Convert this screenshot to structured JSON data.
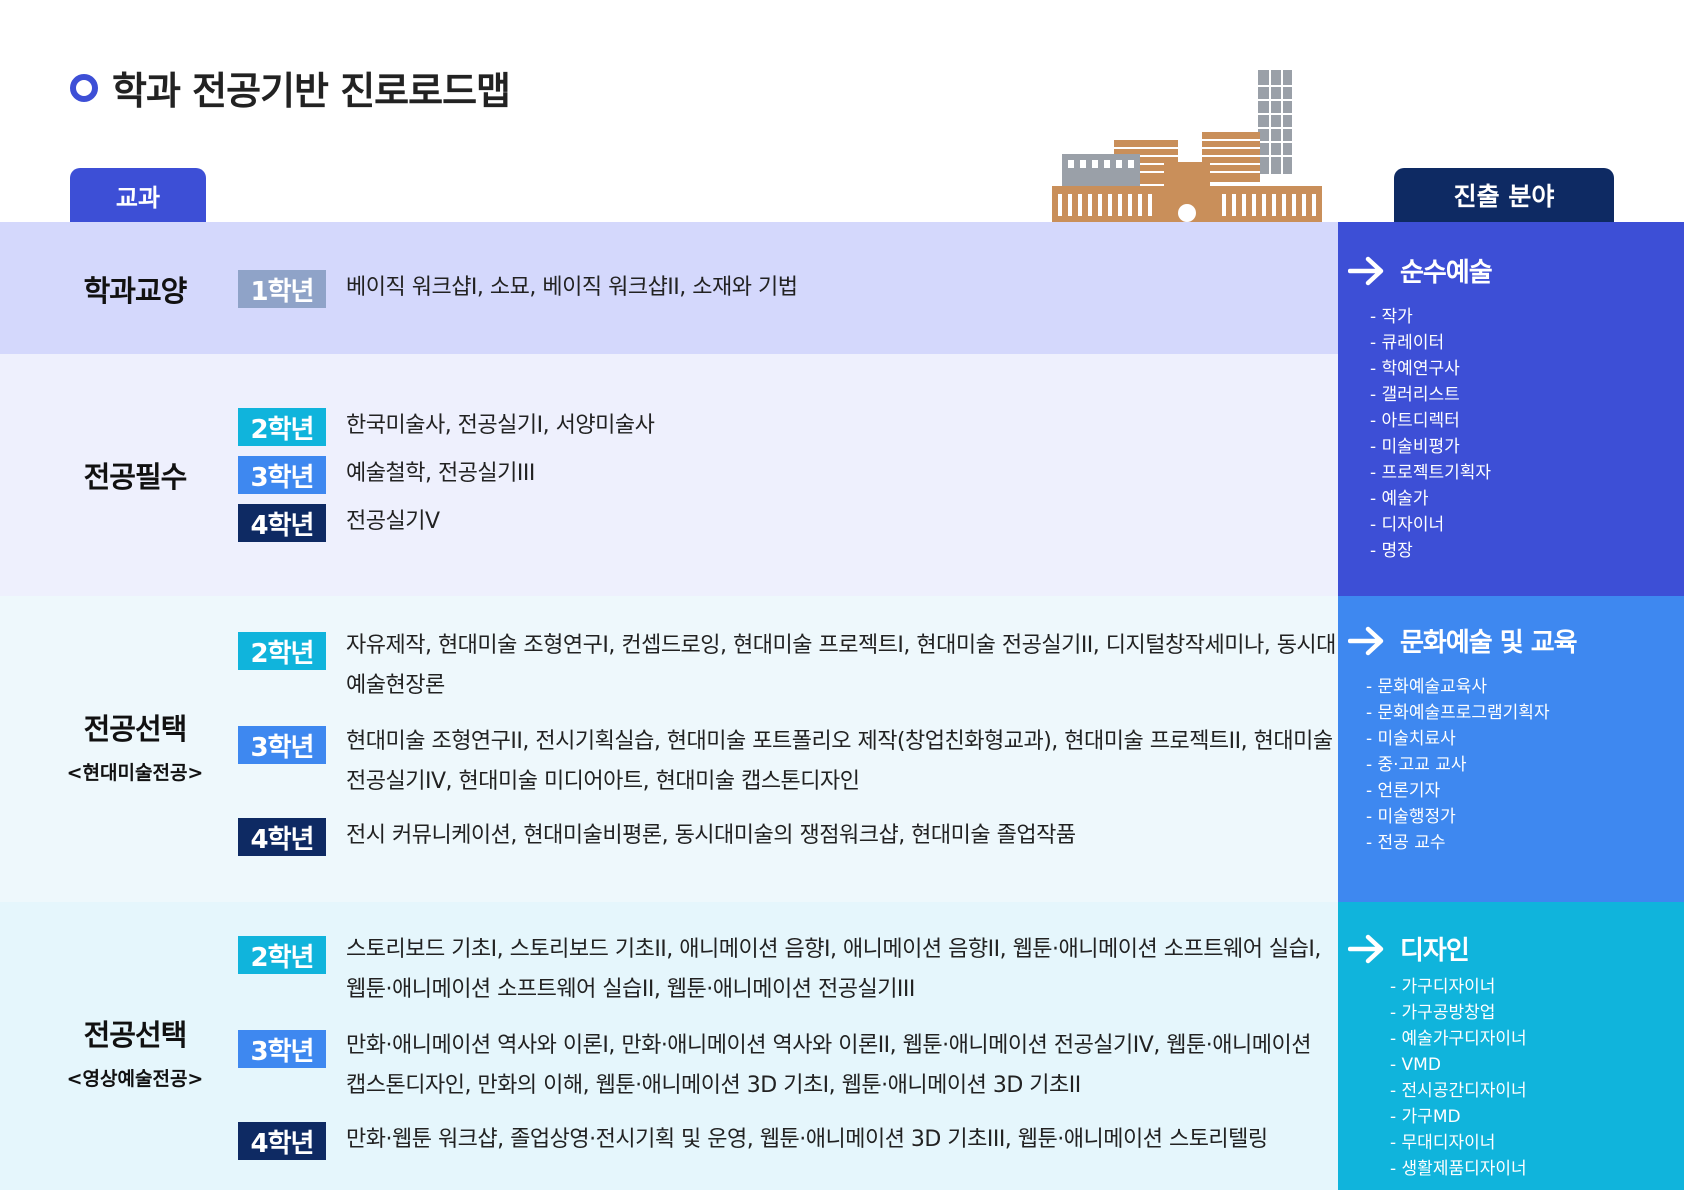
{
  "header": {
    "title": "학과 전공기반 진로로드맵",
    "left_tab": "교과",
    "right_tab": "진출 분야"
  },
  "rows": {
    "liberal": {
      "category": "학과교양",
      "items": [
        {
          "grade": "1학년",
          "courses": "베이직 워크샵I, 소묘, 베이직 워크샵II, 소재와 기법"
        }
      ]
    },
    "required": {
      "category": "전공필수",
      "items": [
        {
          "grade": "2학년",
          "courses": "한국미술사, 전공실기I, 서양미술사"
        },
        {
          "grade": "3학년",
          "courses": "예술철학, 전공실기III"
        },
        {
          "grade": "4학년",
          "courses": "전공실기V"
        }
      ]
    },
    "elective_contemporary": {
      "category": "전공선택",
      "sub": "<현대미술전공>",
      "items": [
        {
          "grade": "2학년",
          "courses": "자유제작, 현대미술 조형연구I, 컨셉드로잉, 현대미술 프로젝트I, 현대미술 전공실기II, 디지털창작세미나, 동시대예술현장론"
        },
        {
          "grade": "3학년",
          "courses": "현대미술 조형연구II, 전시기획실습, 현대미술 포트폴리오 제작(창업친화형교과), 현대미술 프로젝트II, 현대미술 전공실기IV, 현대미술 미디어아트, 현대미술 캡스톤디자인"
        },
        {
          "grade": "4학년",
          "courses": "전시 커뮤니케이션, 현대미술비평론, 동시대미술의 쟁점워크샵, 현대미술 졸업작품"
        }
      ]
    },
    "elective_media": {
      "category": "전공선택",
      "sub": "<영상예술전공>",
      "items": [
        {
          "grade": "2학년",
          "courses": "스토리보드 기초I, 스토리보드 기초II, 애니메이션 음향I, 애니메이션 음향II, 웹툰·애니메이션 소프트웨어 실습I, 웹툰·애니메이션 소프트웨어 실습II, 웹툰·애니메이션 전공실기III"
        },
        {
          "grade": "3학년",
          "courses": "만화·애니메이션 역사와 이론I, 만화·애니메이션 역사와 이론II, 웹툰·애니메이션 전공실기IV, 웹툰·애니메이션 캡스톤디자인, 만화의 이해, 웹툰·애니메이션 3D 기초I, 웹툰·애니메이션 3D 기초II"
        },
        {
          "grade": "4학년",
          "courses": "만화·웹툰 워크샵, 졸업상영·전시기획 및 운영, 웹툰·애니메이션 3D 기초III, 웹툰·애니메이션 스토리텔링"
        }
      ]
    }
  },
  "careers": {
    "fine_art": {
      "title": "순수예술",
      "items": [
        "- 작가",
        "- 큐레이터",
        "- 학예연구사",
        "- 갤러리스트",
        "- 아트디렉터",
        "- 미술비평가",
        "- 프로젝트기획자",
        "- 예술가",
        "- 디자이너",
        "- 명장"
      ]
    },
    "culture_edu": {
      "title": "문화예술 및 교육",
      "items": [
        "- 문화예술교육사",
        "- 문화예술프로그램기획자",
        "- 미술치료사",
        "- 중·고교 교사",
        "- 언론기자",
        "- 미술행정가",
        "- 전공 교수"
      ]
    },
    "design": {
      "title": "디자인",
      "items": [
        "- 가구디자이너",
        "- 가구공방창업",
        "- 예술가구디자이너",
        "- VMD",
        "- 전시공간디자이너",
        "- 가구MD",
        "- 무대디자이너",
        "- 생활제품디자이너"
      ]
    }
  },
  "colors": {
    "accent": "#3d4fd6",
    "navy": "#0e2a63",
    "sky": "#10b4dc",
    "blue": "#3e88f0",
    "grade1": "#8fa3c8",
    "building_brown": "#c98f5a",
    "building_gray": "#9aa0a8"
  }
}
